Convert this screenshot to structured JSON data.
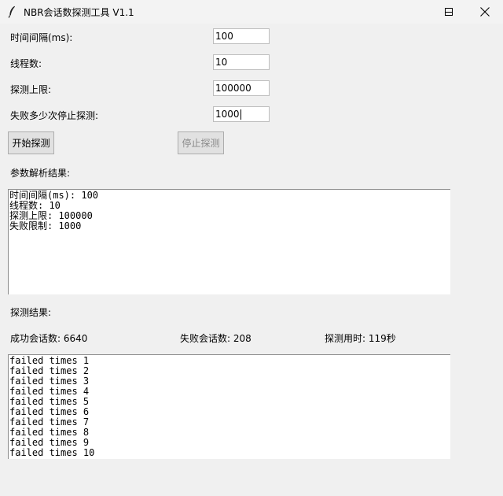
{
  "window": {
    "title": "NBR会话数探测工具 V1.1",
    "icons": {
      "app": "feather-icon",
      "minimize": "minimize-icon",
      "maximize": "maximize-icon",
      "close": "close-icon"
    }
  },
  "form": {
    "interval_label": "时间间隔(ms):",
    "interval_value": "100",
    "threads_label": "线程数:",
    "threads_value": "10",
    "limit_label": "探测上限:",
    "limit_value": "100000",
    "fail_label": "失败多少次停止探测:",
    "fail_value": "1000"
  },
  "buttons": {
    "start": "开始探测",
    "stop": "停止探测"
  },
  "params": {
    "heading": "参数解析结果:",
    "lines": [
      "时间间隔(ms): 100",
      "线程数: 10",
      "探测上限: 100000",
      "失败限制: 1000"
    ]
  },
  "results": {
    "heading": "探测结果:",
    "success": "成功会话数: 6640",
    "failed": "失败会话数: 208",
    "elapsed": "探测用时: 119秒",
    "log": [
      "failed times 1",
      "failed times 2",
      "failed times 3",
      "failed times 4",
      "failed times 5",
      "failed times 6",
      "failed times 7",
      "failed times 8",
      "failed times 9",
      "failed times 10"
    ]
  }
}
